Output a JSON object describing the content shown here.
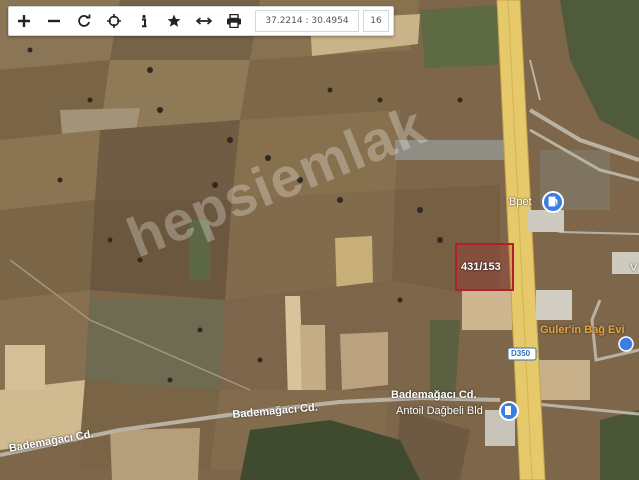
{
  "toolbar": {
    "buttons": [
      {
        "name": "zoom-in-button",
        "icon": "plus-icon"
      },
      {
        "name": "zoom-out-button",
        "icon": "minus-icon"
      },
      {
        "name": "refresh-button",
        "icon": "refresh-icon"
      },
      {
        "name": "locate-button",
        "icon": "crosshair-icon"
      },
      {
        "name": "info-button",
        "icon": "info-icon"
      },
      {
        "name": "favorite-button",
        "icon": "star-icon"
      },
      {
        "name": "measure-button",
        "icon": "arrows-horizontal-icon"
      },
      {
        "name": "print-button",
        "icon": "printer-icon"
      }
    ],
    "coordinates": "37.2214 : 30.4954",
    "zoom_level": "16"
  },
  "map": {
    "parcel_label": "431/153",
    "parcel_color": "#b0202a",
    "road_labels": {
      "bademagaci_left": "Bademağacı Cd.",
      "bademagaci_mid": "Bademağacı Cd.",
      "bademagaci_right": "Bademağacı Cd.",
      "road_shield": "D350"
    },
    "poi_labels": {
      "bpet": "Bpet",
      "guler": "Guler'in Bağ Evi",
      "antoil": "Antoil Dağbeli Bld"
    },
    "edge_label": "V",
    "watermark": "hepsiemlak",
    "poi_pin_color": "#3b7de0",
    "highway_color": "#e6c96a"
  }
}
